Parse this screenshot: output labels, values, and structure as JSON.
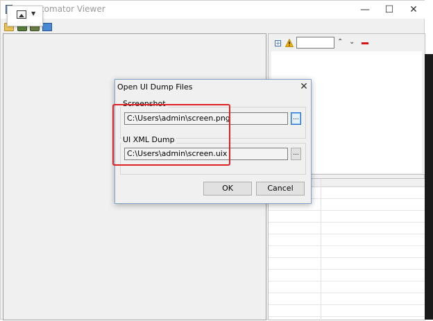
{
  "window": {
    "title": "UI Automator Viewer",
    "controls": {
      "minimize": "—",
      "maximize": "☐",
      "close": "✕"
    }
  },
  "toolbar": {
    "items": [
      "folder-open-icon",
      "device-screenshot-icon",
      "device-screenshot-compressed-icon",
      "save-icon"
    ]
  },
  "right_panel": {
    "search_value": ""
  },
  "dialog": {
    "title": "Open UI Dump Files",
    "close_label": "✕",
    "screenshot": {
      "label": "Screenshot",
      "path": "C:\\Users\\admin\\screen.png",
      "browse_label": "..."
    },
    "xml_dump": {
      "label": "UI XML Dump",
      "path": "C:\\Users\\admin\\screen.uix",
      "browse_label": "..."
    },
    "ok_label": "OK",
    "cancel_label": "Cancel"
  },
  "colors": {
    "highlight": "#e02020",
    "focus": "#1e6fd6"
  }
}
